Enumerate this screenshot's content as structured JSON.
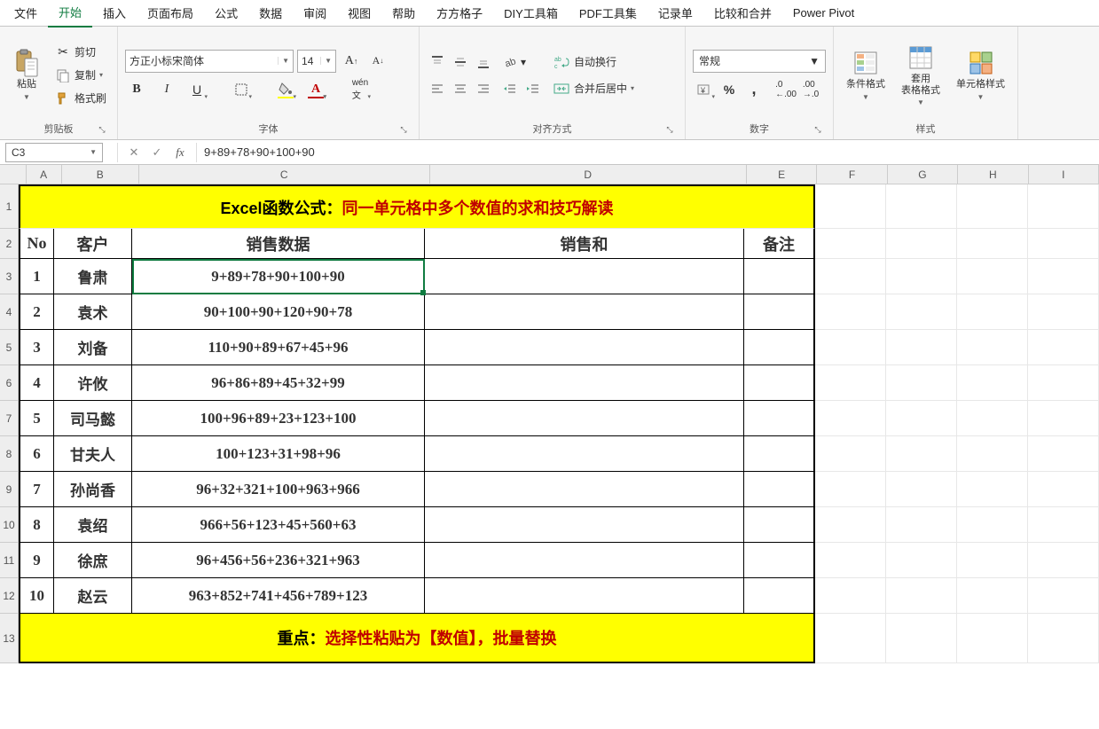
{
  "menu": {
    "tabs": [
      "文件",
      "开始",
      "插入",
      "页面布局",
      "公式",
      "数据",
      "审阅",
      "视图",
      "帮助",
      "方方格子",
      "DIY工具箱",
      "PDF工具集",
      "记录单",
      "比较和合并",
      "Power Pivot"
    ],
    "active": "开始"
  },
  "ribbon": {
    "clipboard": {
      "label": "剪贴板",
      "paste": "粘贴",
      "cut": "剪切",
      "copy": "复制",
      "format_painter": "格式刷"
    },
    "font": {
      "label": "字体",
      "name": "方正小标宋简体",
      "size": "14",
      "bold": "B",
      "italic": "I",
      "underline": "U"
    },
    "align": {
      "label": "对齐方式",
      "wrap": "自动换行",
      "merge": "合并后居中"
    },
    "number": {
      "label": "数字",
      "format": "常规"
    },
    "styles": {
      "label": "样式",
      "cond": "条件格式",
      "table": "套用\n表格格式",
      "cell": "单元格样式"
    }
  },
  "formula_bar": {
    "cell_ref": "C3",
    "formula": "9+89+78+90+100+90"
  },
  "columns": [
    "A",
    "B",
    "C",
    "D",
    "E",
    "F",
    "G",
    "H",
    "I"
  ],
  "title": {
    "t1": "Excel函数公式：",
    "t2": "同一单元格中多个数值的求和技巧解读"
  },
  "headers": {
    "no": "No",
    "cust": "客户",
    "sales": "销售数据",
    "sum": "销售和",
    "note": "备注"
  },
  "rows": [
    {
      "no": "1",
      "name": "鲁肃",
      "val": "9+89+78+90+100+90"
    },
    {
      "no": "2",
      "name": "袁术",
      "val": "90+100+90+120+90+78"
    },
    {
      "no": "3",
      "name": "刘备",
      "val": "110+90+89+67+45+96"
    },
    {
      "no": "4",
      "name": "许攸",
      "val": "96+86+89+45+32+99"
    },
    {
      "no": "5",
      "name": "司马懿",
      "val": "100+96+89+23+123+100"
    },
    {
      "no": "6",
      "name": "甘夫人",
      "val": "100+123+31+98+96"
    },
    {
      "no": "7",
      "name": "孙尚香",
      "val": "96+32+321+100+963+966"
    },
    {
      "no": "8",
      "name": "袁绍",
      "val": "966+56+123+45+560+63"
    },
    {
      "no": "9",
      "name": "徐庶",
      "val": "96+456+56+236+321+963"
    },
    {
      "no": "10",
      "name": "赵云",
      "val": "963+852+741+456+789+123"
    }
  ],
  "footer": {
    "t1": "重点：",
    "t2": "选择性粘贴为【数值】，批量替换"
  }
}
